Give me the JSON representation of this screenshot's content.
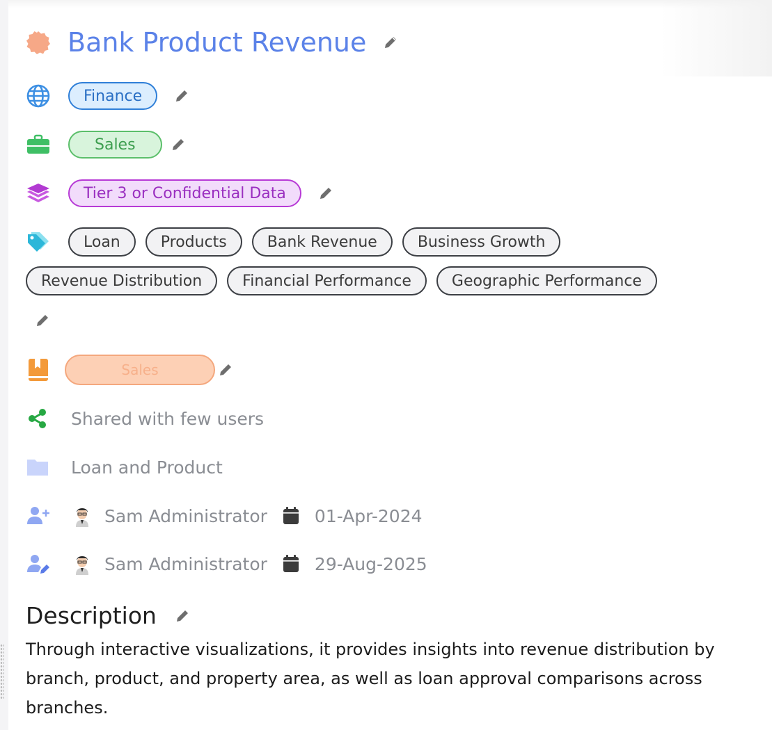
{
  "title": "Bank Product Revenue",
  "domain": {
    "label": "Finance",
    "icon": "globe-icon"
  },
  "department": {
    "label": "Sales",
    "icon": "briefcase-icon"
  },
  "classification": {
    "label": "Tier 3 or Confidential Data",
    "icon": "layers-icon"
  },
  "tags": {
    "icon": "tag-icon",
    "items": [
      "Loan",
      "Products",
      "Bank Revenue",
      "Business Growth",
      "Revenue Distribution",
      "Financial Performance",
      "Geographic Performance"
    ]
  },
  "catalog": {
    "label": "Sales",
    "icon": "book-icon"
  },
  "sharing": {
    "label": "Shared with few users",
    "icon": "share-icon"
  },
  "folder": {
    "label": "Loan and Product",
    "icon": "folder-icon"
  },
  "created": {
    "user": "Sam Administrator",
    "date": "01-Apr-2024",
    "icon": "user-plus-icon"
  },
  "modified": {
    "user": "Sam Administrator",
    "date": "29-Aug-2025",
    "icon": "user-edit-icon"
  },
  "description": {
    "heading": "Description",
    "text": "Through interactive visualizations, it provides insights into revenue distribution by branch, product, and property area, as well as loan approval comparisons across branches."
  },
  "colors": {
    "title": "#5b82e8",
    "finance": "#2f7fd8",
    "sales": "#5bbf6a",
    "classification": "#b73ad6",
    "catalog": "#f4a77d",
    "share": "#27a843"
  }
}
